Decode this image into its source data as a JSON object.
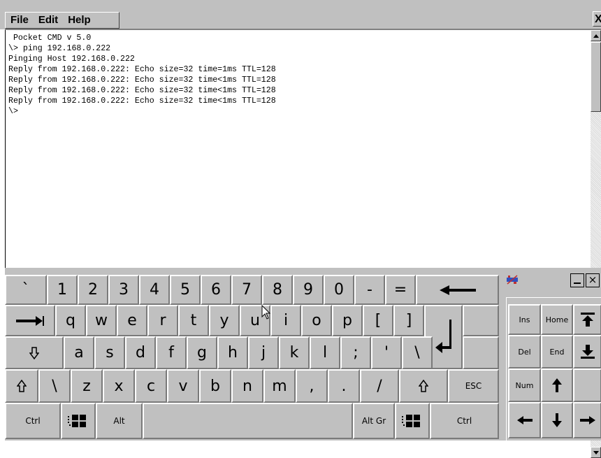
{
  "menu": {
    "file": "File",
    "edit": "Edit",
    "help": "Help",
    "close": "X"
  },
  "console": {
    "lines": [
      " Pocket CMD v 5.0",
      "\\> ping 192.168.0.222",
      "Pinging Host 192.168.0.222",
      "Reply from 192.168.0.222: Echo size=32 time=1ms TTL=128",
      "Reply from 192.168.0.222: Echo size=32 time<1ms TTL=128",
      "Reply from 192.168.0.222: Echo size=32 time<1ms TTL=128",
      "Reply from 192.168.0.222: Echo size=32 time<1ms TTL=128",
      "\\>"
    ]
  },
  "keyboard": {
    "row1": [
      "`",
      "1",
      "2",
      "3",
      "4",
      "5",
      "6",
      "7",
      "8",
      "9",
      "0",
      "-",
      "="
    ],
    "row2": [
      "q",
      "w",
      "e",
      "r",
      "t",
      "y",
      "u",
      "i",
      "o",
      "p",
      "[",
      "]"
    ],
    "row3": [
      "a",
      "s",
      "d",
      "f",
      "g",
      "h",
      "j",
      "k",
      "l",
      ";",
      "'",
      "\\"
    ],
    "row4": [
      "\\",
      "z",
      "x",
      "c",
      "v",
      "b",
      "n",
      "m",
      ",",
      ".",
      "/"
    ],
    "esc": "ESC",
    "ctrl_left": "Ctrl",
    "alt": "Alt",
    "alt_gr": "Alt Gr",
    "ctrl_right": "Ctrl"
  },
  "navpad": {
    "ins": "Ins",
    "home": "Home",
    "del": "Del",
    "end": "End",
    "num": "Num",
    "close": "×"
  }
}
